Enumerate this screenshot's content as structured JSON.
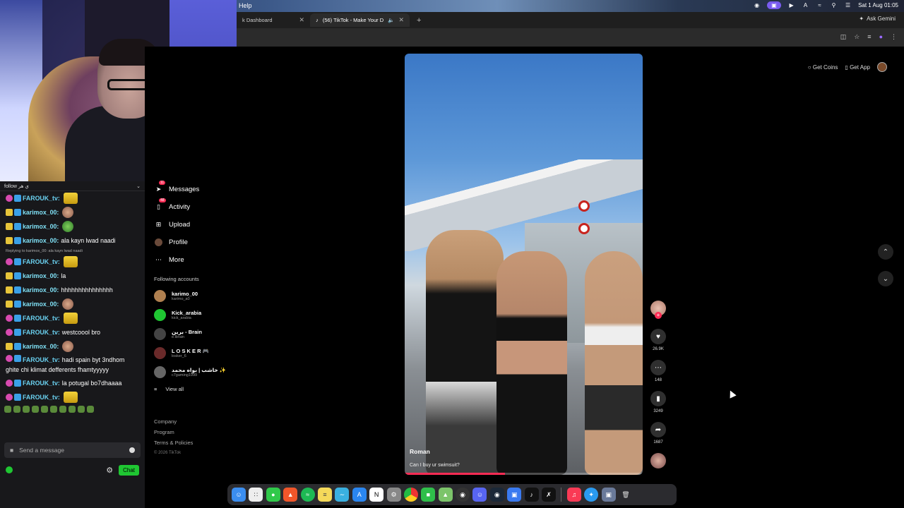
{
  "menubar": {
    "help": "Help",
    "clock": "Sat 1 Aug  01:05",
    "icons": [
      "shield-icon",
      "screen-record-icon",
      "play-icon",
      "text-icon",
      "wifi-icon",
      "search-icon",
      "control-center-icon"
    ]
  },
  "browser": {
    "tabs": [
      {
        "label": "k Dashboard",
        "active": false
      },
      {
        "label": "(56) TikTok - Make Your D",
        "active": true
      }
    ],
    "ask_gemini": "Ask Gemini"
  },
  "chat": {
    "header": "follow ي هر",
    "messages": [
      {
        "user": "FAROUK_tv:",
        "text": "",
        "emote": "gold",
        "kind": "farouk"
      },
      {
        "user": "karimox_00:",
        "text": "",
        "emote": "face",
        "kind": "karimo"
      },
      {
        "user": "karimox_00:",
        "text": "",
        "emote": "frog",
        "kind": "karimo"
      },
      {
        "user": "karimox_00:",
        "text": "ala kayn lwad naadi",
        "emote": "",
        "kind": "karimo"
      },
      {
        "reply": "Replying to karimox_00: ala kayn lwad naadi"
      },
      {
        "user": "FAROUK_tv:",
        "text": "",
        "emote": "gold",
        "kind": "farouk"
      },
      {
        "user": "karimox_00:",
        "text": "la",
        "emote": "",
        "kind": "karimo"
      },
      {
        "user": "karimox_00:",
        "text": "hhhhhhhhhhhhhhh",
        "emote": "",
        "kind": "karimo"
      },
      {
        "user": "karimox_00:",
        "text": "",
        "emote": "face",
        "kind": "karimo"
      },
      {
        "user": "FAROUK_tv:",
        "text": "",
        "emote": "gold",
        "kind": "farouk"
      },
      {
        "user": "FAROUK_tv:",
        "text": "westcoool bro",
        "emote": "",
        "kind": "farouk"
      },
      {
        "user": "karimox_00:",
        "text": "",
        "emote": "face",
        "kind": "karimo"
      },
      {
        "user": "FAROUK_tv:",
        "text": "hadi spain byt 3ndhom ghite chi klimat defferents fhamtyyyyy",
        "emote": "",
        "kind": "farouk",
        "multiline": true
      },
      {
        "user": "FAROUK_tv:",
        "text": "la potugal bo7dhaaaa",
        "emote": "",
        "kind": "farouk"
      },
      {
        "user": "FAROUK_tv:",
        "text": "",
        "emote": "gold",
        "kind": "farouk"
      }
    ],
    "input_placeholder": "Send a message",
    "chat_button": "Chat"
  },
  "tiktok": {
    "nav": [
      {
        "label": "Messages",
        "badge": "11",
        "icon": "send-icon"
      },
      {
        "label": "Activity",
        "badge": "48",
        "icon": "inbox-icon"
      },
      {
        "label": "Upload",
        "badge": "",
        "icon": "upload-icon"
      },
      {
        "label": "Profile",
        "badge": "",
        "icon": "profile-icon"
      },
      {
        "label": "More",
        "badge": "",
        "icon": "more-icon"
      }
    ],
    "following_header": "Following accounts",
    "accounts": [
      {
        "name": "karimo_00",
        "handle": "karimo_a0"
      },
      {
        "name": "Kick_arabia",
        "handle": "kick_arabia"
      },
      {
        "name": "برين - Brain",
        "handle": "e.lbrain"
      },
      {
        "name": "L O S K E R 🎮",
        "handle": "losker_6"
      },
      {
        "name": "خاشب | بواه محمد ✨",
        "handle": "c7gaming1999"
      }
    ],
    "view_all": "View all",
    "footer": [
      "Company",
      "Program",
      "Terms & Policies"
    ],
    "copyright": "© 2026 TikTok",
    "get_coins": "Get Coins",
    "get_app": "Get App",
    "video": {
      "author": "Roman",
      "caption": "Can I buy ur swimsuit?",
      "progress": 0.42
    },
    "actions": {
      "likes": "26.9K",
      "comments": "148",
      "saves": "3249",
      "shares": "1687"
    }
  }
}
